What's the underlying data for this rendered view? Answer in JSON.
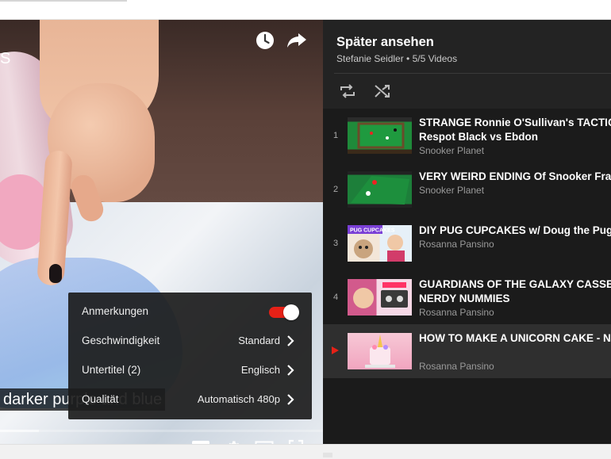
{
  "player": {
    "title_fragment": "S",
    "caption": "darker purple and blue",
    "progress_fraction": 0.12,
    "top_icons": [
      "clock-icon",
      "share-icon"
    ],
    "bottom_icons": [
      "subtitles-icon",
      "settings-icon",
      "theater-mode-icon",
      "fullscreen-icon"
    ],
    "accent": "#e62117",
    "settings": {
      "annotations_label": "Anmerkungen",
      "annotations_on": true,
      "speed_label": "Geschwindigkeit",
      "speed_value": "Standard",
      "subtitles_label": "Untertitel (2)",
      "subtitles_value": "Englisch",
      "quality_label": "Qualität",
      "quality_value": "Automatisch 480p"
    }
  },
  "playlist": {
    "title": "Später ansehen",
    "subtitle": "Stefanie Seidler • 5/5 Videos",
    "tools": [
      "repeat-icon",
      "shuffle-icon"
    ],
    "items": [
      {
        "index": "1",
        "title1": "STRANGE Ronnie O'Sullivan's TACTICA",
        "title2": "Respot Black vs Ebdon",
        "channel": "Snooker Planet",
        "thumb": "snooker-table-thumbnail",
        "active": false
      },
      {
        "index": "2",
        "title1": "VERY WEIRD ENDING Of Snooker Fran",
        "title2": "",
        "channel": "Snooker Planet",
        "thumb": "snooker-table-thumbnail",
        "active": false
      },
      {
        "index": "3",
        "title1": "DIY PUG CUPCAKES w/ Doug the Pug",
        "title2": "",
        "channel": "Rosanna Pansino",
        "thumb": "pug-cupcakes-thumbnail",
        "thumb_text": "PUG CUPCAKES",
        "active": false
      },
      {
        "index": "4",
        "title1": "GUARDIANS OF THE GALAXY CASSET",
        "title2": "NERDY NUMMIES",
        "channel": "Rosanna Pansino",
        "thumb": "cassette-cake-thumbnail",
        "active": false
      },
      {
        "index": "",
        "title1": "HOW TO MAKE A UNICORN CAKE - NE",
        "title2": "",
        "channel": "Rosanna Pansino",
        "thumb": "unicorn-cake-thumbnail",
        "active": true
      }
    ]
  }
}
